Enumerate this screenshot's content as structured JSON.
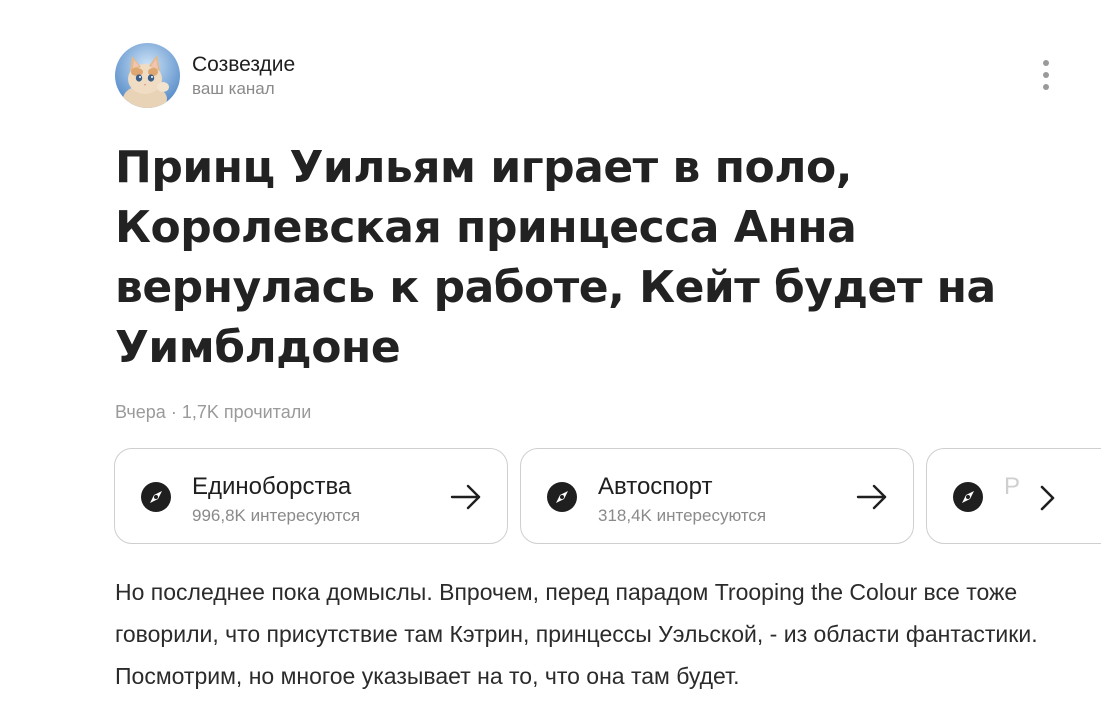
{
  "channel": {
    "name": "Созвездие",
    "subtitle": "ваш канал",
    "avatar_icon": "kitten-avatar"
  },
  "menu_icon": "vertical-dots-icon",
  "article": {
    "title": "Принц Уильям играет в поло, Королевская принцесса Анна вернулась к работе, Кейт будет на Уимблдоне",
    "meta": "Вчера · 1,7K прочитали",
    "body": "Но последнее пока домыслы. Впрочем, перед парадом Trooping the Colour все тоже говорили, что присутствие там Кэтрин, принцессы Уэльской, - из области фантастики. Посмотрим, но многое указывает на то, что она там будет."
  },
  "topics": [
    {
      "title": "Единоборства",
      "count": "996,8K интересуются",
      "icon": "compass-icon"
    },
    {
      "title": "Автоспорт",
      "count": "318,4K интересуются",
      "icon": "compass-icon"
    },
    {
      "title": "Р",
      "count": "",
      "icon": "compass-icon"
    }
  ],
  "topics_next_icon": "chevron-right-icon",
  "colors": {
    "text": "#222222",
    "muted": "#8a8a8a",
    "card_border": "#cfcfcf"
  }
}
